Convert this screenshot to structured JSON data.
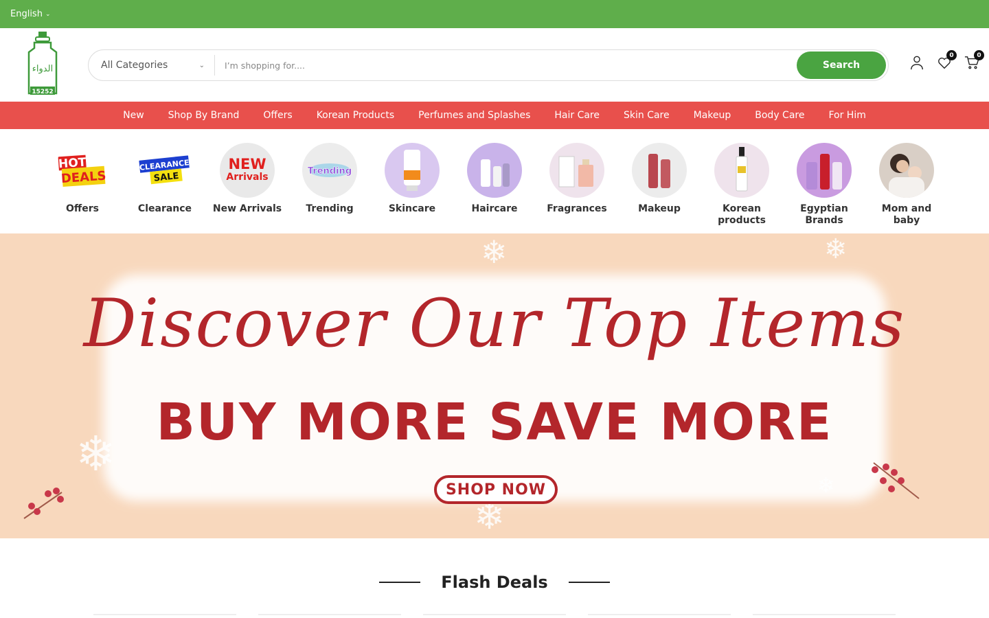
{
  "topbar": {
    "language": "English"
  },
  "header": {
    "logo_text": "15252",
    "search": {
      "category": "All Categories",
      "placeholder": "I’m shopping for....",
      "button_label": "Search"
    },
    "wishlist_count": "0",
    "cart_count": "0"
  },
  "nav": {
    "items": [
      "New",
      "Shop By Brand",
      "Offers",
      "Korean Products",
      "Perfumes and Splashes",
      "Hair Care",
      "Skin Care",
      "Makeup",
      "Body Care",
      "For Him"
    ]
  },
  "categories": [
    {
      "label": "Offers",
      "icon": "hot-deals-icon",
      "badge_top": "HOT",
      "badge_bottom": "DEALS"
    },
    {
      "label": "Clearance",
      "icon": "clearance-sale-icon",
      "badge_top": "CLEARANCE",
      "badge_bottom": "SALE"
    },
    {
      "label": "New Arrivals",
      "icon": "new-arrivals-icon",
      "badge_top": "NEW",
      "badge_bottom": "Arrivals"
    },
    {
      "label": "Trending",
      "icon": "trending-icon",
      "badge_top": "Trending"
    },
    {
      "label": "Skincare",
      "icon": "sunscreen-icon"
    },
    {
      "label": "Haircare",
      "icon": "hair-products-icon"
    },
    {
      "label": "Fragrances",
      "icon": "perfume-icon"
    },
    {
      "label": "Makeup",
      "icon": "lip-tint-icon"
    },
    {
      "label": "Korean products",
      "icon": "serum-icon"
    },
    {
      "label": "Egyptian Brands",
      "icon": "body-products-icon"
    },
    {
      "label": "Mom and baby",
      "icon": "mother-baby-icon"
    }
  ],
  "banner": {
    "script_text": "Discover Our Top Items",
    "headline": "BUY MORE SAVE MORE",
    "cta": "SHOP NOW"
  },
  "flash": {
    "title": "Flash Deals"
  },
  "colors": {
    "topbar": "#5fae4b",
    "nav": "#e8504c",
    "accent": "#b3262b",
    "search_btn": "#4aa441"
  }
}
